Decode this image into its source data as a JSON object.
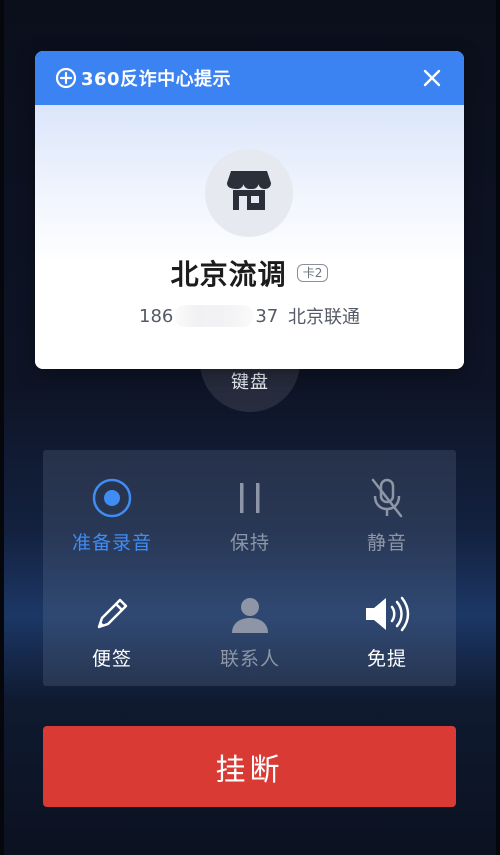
{
  "card": {
    "brand_title": "360反诈中心提示",
    "caller_name": "北京流调",
    "sim_badge": "卡2",
    "number_prefix": "186",
    "number_suffix": "37",
    "carrier": "北京联通",
    "header_color": "#3b82f2"
  },
  "keypad": {
    "label": "键盘"
  },
  "actions": [
    {
      "id": "record",
      "label": "准备录音",
      "icon": "record-icon",
      "state": "active"
    },
    {
      "id": "hold",
      "label": "保持",
      "icon": "pause-icon",
      "state": "disabled"
    },
    {
      "id": "mute",
      "label": "静音",
      "icon": "mic-off-icon",
      "state": "disabled"
    },
    {
      "id": "notes",
      "label": "便签",
      "icon": "pencil-icon",
      "state": "enabled"
    },
    {
      "id": "contacts",
      "label": "联系人",
      "icon": "person-icon",
      "state": "disabled"
    },
    {
      "id": "speaker",
      "label": "免提",
      "icon": "speaker-icon",
      "state": "enabled"
    }
  ],
  "hangup": {
    "label": "挂断",
    "color": "#d93b34"
  }
}
